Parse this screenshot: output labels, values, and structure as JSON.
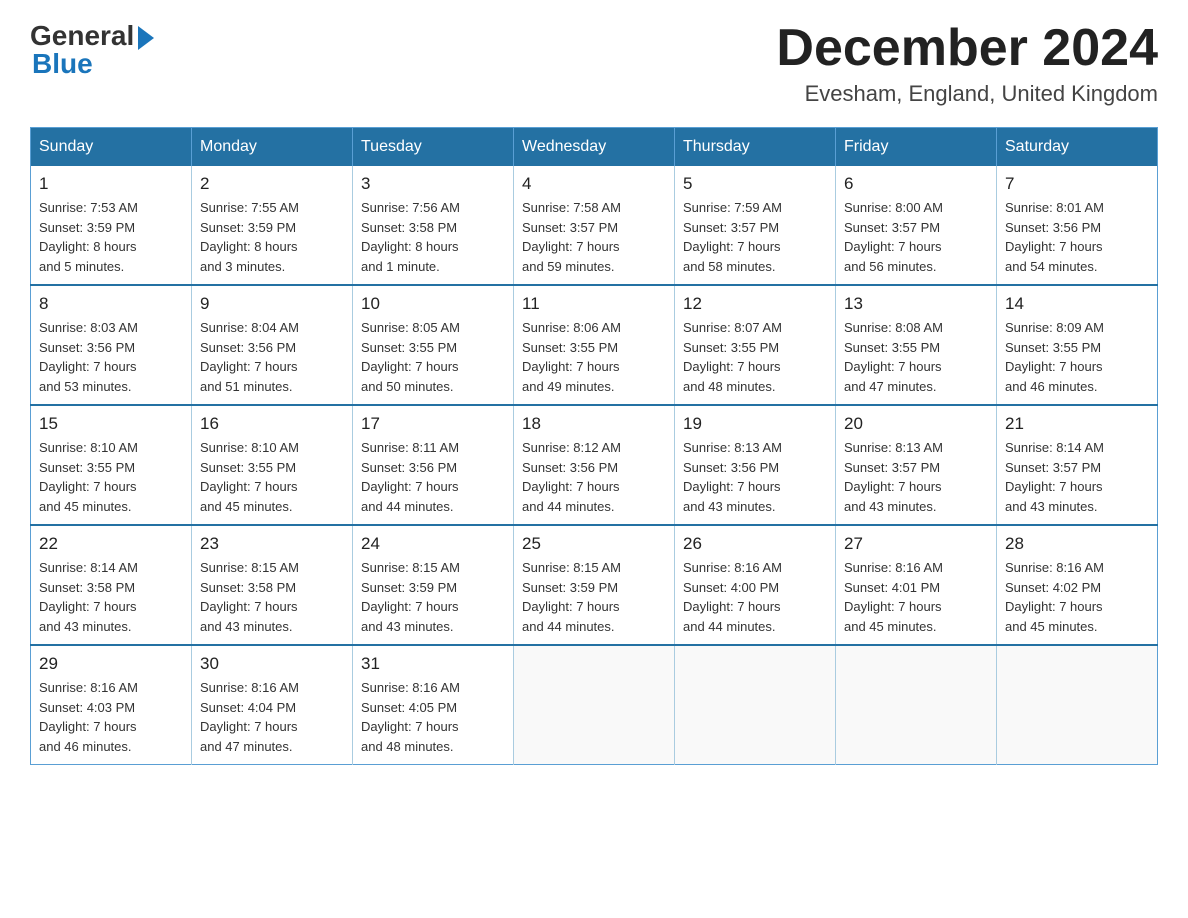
{
  "header": {
    "logo_general": "General",
    "logo_blue": "Blue",
    "main_title": "December 2024",
    "subtitle": "Evesham, England, United Kingdom"
  },
  "calendar": {
    "days_of_week": [
      "Sunday",
      "Monday",
      "Tuesday",
      "Wednesday",
      "Thursday",
      "Friday",
      "Saturday"
    ],
    "weeks": [
      [
        {
          "day": "1",
          "info": "Sunrise: 7:53 AM\nSunset: 3:59 PM\nDaylight: 8 hours\nand 5 minutes."
        },
        {
          "day": "2",
          "info": "Sunrise: 7:55 AM\nSunset: 3:59 PM\nDaylight: 8 hours\nand 3 minutes."
        },
        {
          "day": "3",
          "info": "Sunrise: 7:56 AM\nSunset: 3:58 PM\nDaylight: 8 hours\nand 1 minute."
        },
        {
          "day": "4",
          "info": "Sunrise: 7:58 AM\nSunset: 3:57 PM\nDaylight: 7 hours\nand 59 minutes."
        },
        {
          "day": "5",
          "info": "Sunrise: 7:59 AM\nSunset: 3:57 PM\nDaylight: 7 hours\nand 58 minutes."
        },
        {
          "day": "6",
          "info": "Sunrise: 8:00 AM\nSunset: 3:57 PM\nDaylight: 7 hours\nand 56 minutes."
        },
        {
          "day": "7",
          "info": "Sunrise: 8:01 AM\nSunset: 3:56 PM\nDaylight: 7 hours\nand 54 minutes."
        }
      ],
      [
        {
          "day": "8",
          "info": "Sunrise: 8:03 AM\nSunset: 3:56 PM\nDaylight: 7 hours\nand 53 minutes."
        },
        {
          "day": "9",
          "info": "Sunrise: 8:04 AM\nSunset: 3:56 PM\nDaylight: 7 hours\nand 51 minutes."
        },
        {
          "day": "10",
          "info": "Sunrise: 8:05 AM\nSunset: 3:55 PM\nDaylight: 7 hours\nand 50 minutes."
        },
        {
          "day": "11",
          "info": "Sunrise: 8:06 AM\nSunset: 3:55 PM\nDaylight: 7 hours\nand 49 minutes."
        },
        {
          "day": "12",
          "info": "Sunrise: 8:07 AM\nSunset: 3:55 PM\nDaylight: 7 hours\nand 48 minutes."
        },
        {
          "day": "13",
          "info": "Sunrise: 8:08 AM\nSunset: 3:55 PM\nDaylight: 7 hours\nand 47 minutes."
        },
        {
          "day": "14",
          "info": "Sunrise: 8:09 AM\nSunset: 3:55 PM\nDaylight: 7 hours\nand 46 minutes."
        }
      ],
      [
        {
          "day": "15",
          "info": "Sunrise: 8:10 AM\nSunset: 3:55 PM\nDaylight: 7 hours\nand 45 minutes."
        },
        {
          "day": "16",
          "info": "Sunrise: 8:10 AM\nSunset: 3:55 PM\nDaylight: 7 hours\nand 45 minutes."
        },
        {
          "day": "17",
          "info": "Sunrise: 8:11 AM\nSunset: 3:56 PM\nDaylight: 7 hours\nand 44 minutes."
        },
        {
          "day": "18",
          "info": "Sunrise: 8:12 AM\nSunset: 3:56 PM\nDaylight: 7 hours\nand 44 minutes."
        },
        {
          "day": "19",
          "info": "Sunrise: 8:13 AM\nSunset: 3:56 PM\nDaylight: 7 hours\nand 43 minutes."
        },
        {
          "day": "20",
          "info": "Sunrise: 8:13 AM\nSunset: 3:57 PM\nDaylight: 7 hours\nand 43 minutes."
        },
        {
          "day": "21",
          "info": "Sunrise: 8:14 AM\nSunset: 3:57 PM\nDaylight: 7 hours\nand 43 minutes."
        }
      ],
      [
        {
          "day": "22",
          "info": "Sunrise: 8:14 AM\nSunset: 3:58 PM\nDaylight: 7 hours\nand 43 minutes."
        },
        {
          "day": "23",
          "info": "Sunrise: 8:15 AM\nSunset: 3:58 PM\nDaylight: 7 hours\nand 43 minutes."
        },
        {
          "day": "24",
          "info": "Sunrise: 8:15 AM\nSunset: 3:59 PM\nDaylight: 7 hours\nand 43 minutes."
        },
        {
          "day": "25",
          "info": "Sunrise: 8:15 AM\nSunset: 3:59 PM\nDaylight: 7 hours\nand 44 minutes."
        },
        {
          "day": "26",
          "info": "Sunrise: 8:16 AM\nSunset: 4:00 PM\nDaylight: 7 hours\nand 44 minutes."
        },
        {
          "day": "27",
          "info": "Sunrise: 8:16 AM\nSunset: 4:01 PM\nDaylight: 7 hours\nand 45 minutes."
        },
        {
          "day": "28",
          "info": "Sunrise: 8:16 AM\nSunset: 4:02 PM\nDaylight: 7 hours\nand 45 minutes."
        }
      ],
      [
        {
          "day": "29",
          "info": "Sunrise: 8:16 AM\nSunset: 4:03 PM\nDaylight: 7 hours\nand 46 minutes."
        },
        {
          "day": "30",
          "info": "Sunrise: 8:16 AM\nSunset: 4:04 PM\nDaylight: 7 hours\nand 47 minutes."
        },
        {
          "day": "31",
          "info": "Sunrise: 8:16 AM\nSunset: 4:05 PM\nDaylight: 7 hours\nand 48 minutes."
        },
        {
          "day": "",
          "info": ""
        },
        {
          "day": "",
          "info": ""
        },
        {
          "day": "",
          "info": ""
        },
        {
          "day": "",
          "info": ""
        }
      ]
    ]
  }
}
